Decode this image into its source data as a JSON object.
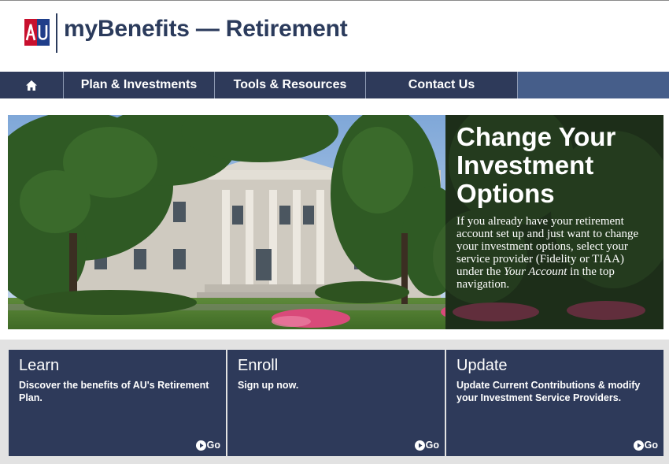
{
  "header": {
    "logo_text": "AU",
    "title": "myBenefits — Retirement"
  },
  "nav": {
    "home_icon": "home-icon",
    "items": [
      {
        "label": "Plan & Investments"
      },
      {
        "label": "Tools & Resources"
      },
      {
        "label": "Contact Us"
      }
    ]
  },
  "hero": {
    "title": "Change Your Investment Options",
    "text_before": "If you already have your retirement account set up and just want to change your investment options, select your service provider (Fidelity or TIAA) under the ",
    "text_emphasis": "Your Account",
    "text_after": " in the top navigation."
  },
  "cards": [
    {
      "title": "Learn",
      "description": "Discover the benefits of AU's Retirement Plan.",
      "go_label": "Go",
      "go_icon": "play-circle-icon"
    },
    {
      "title": "Enroll",
      "description": "Sign up now.",
      "go_label": "Go",
      "go_icon": "play-circle-icon"
    },
    {
      "title": "Update",
      "description": "Update Current Contributions & modify your Investment Service Providers.",
      "go_label": "Go",
      "go_icon": "play-circle-icon"
    }
  ],
  "colors": {
    "navy": "#2e3a5a",
    "nav_fill": "#465e8a",
    "logo_red": "#c8102e",
    "logo_blue": "#1f3e8a"
  }
}
